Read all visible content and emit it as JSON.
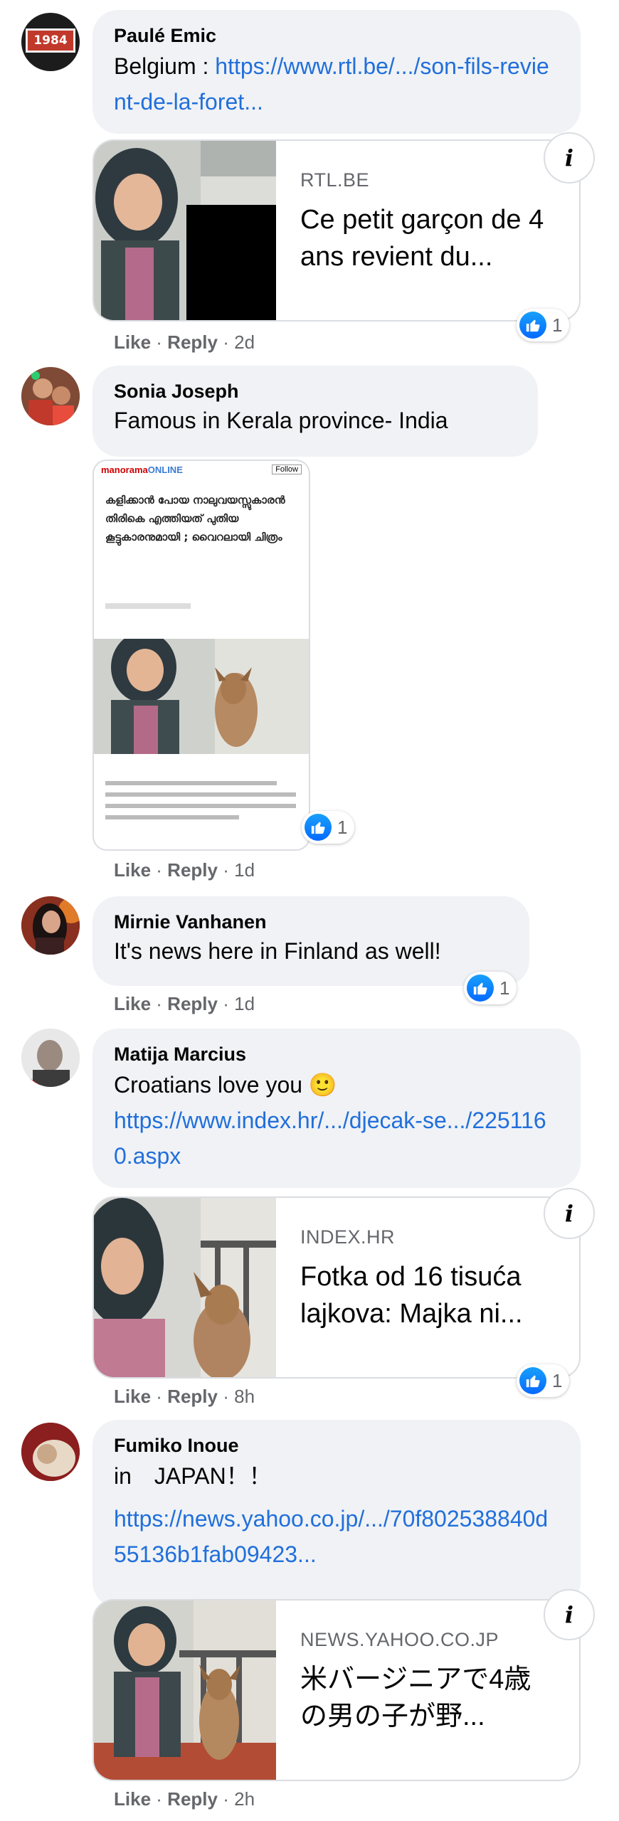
{
  "comments": [
    {
      "author": "Paulé Emic",
      "text": "Belgium :",
      "link": "https://www.rtl.be/.../son-fils-revient-de-la-foret...",
      "preview": {
        "domain": "RTL.BE",
        "title": "Ce petit garçon de 4 ans revient du..."
      },
      "reactions": "1",
      "like": "Like",
      "reply": "Reply",
      "time": "2d",
      "avatar_text": "1984"
    },
    {
      "author": "Sonia Joseph",
      "text": "Famous in Kerala province- India",
      "image": {
        "brand": "manorama",
        "brand2": "ONLINE",
        "follow": "Follow",
        "headline": "കളിക്കാൻ പോയ നാലുവയസ്സുകാരൻ തിരികെ എത്തിയത് പുതിയ കൂട്ടുകാരനുമായി ; വൈറലായി ചിത്രം"
      },
      "reactions": "1",
      "like": "Like",
      "reply": "Reply",
      "time": "1d"
    },
    {
      "author": "Mirnie Vanhanen",
      "text": "It's news here in Finland as well!",
      "reactions": "1",
      "like": "Like",
      "reply": "Reply",
      "time": "1d"
    },
    {
      "author": "Matija Marcius",
      "text": "Croatians love you 🙂",
      "link": "https://www.index.hr/.../djecak-se.../2251160.aspx",
      "preview": {
        "domain": "INDEX.HR",
        "title": "Fotka od 16 tisuća lajkova: Majka ni..."
      },
      "reactions": "1",
      "like": "Like",
      "reply": "Reply",
      "time": "8h"
    },
    {
      "author": "Fumiko Inoue",
      "text": "in　JAPAN！！",
      "link": "https://news.yahoo.co.jp/.../70f802538840d55136b1fab09423...",
      "preview": {
        "domain": "NEWS.YAHOO.CO.JP",
        "title": "米バージニアで4歳の男の子が野..."
      },
      "like": "Like",
      "reply": "Reply",
      "time": "2h"
    }
  ],
  "separator": "·",
  "info_label": "i",
  "colors": {
    "bubble": "#f0f2f5",
    "link": "#216fdb",
    "meta": "#65676b",
    "like_blue": "#0569ff"
  }
}
